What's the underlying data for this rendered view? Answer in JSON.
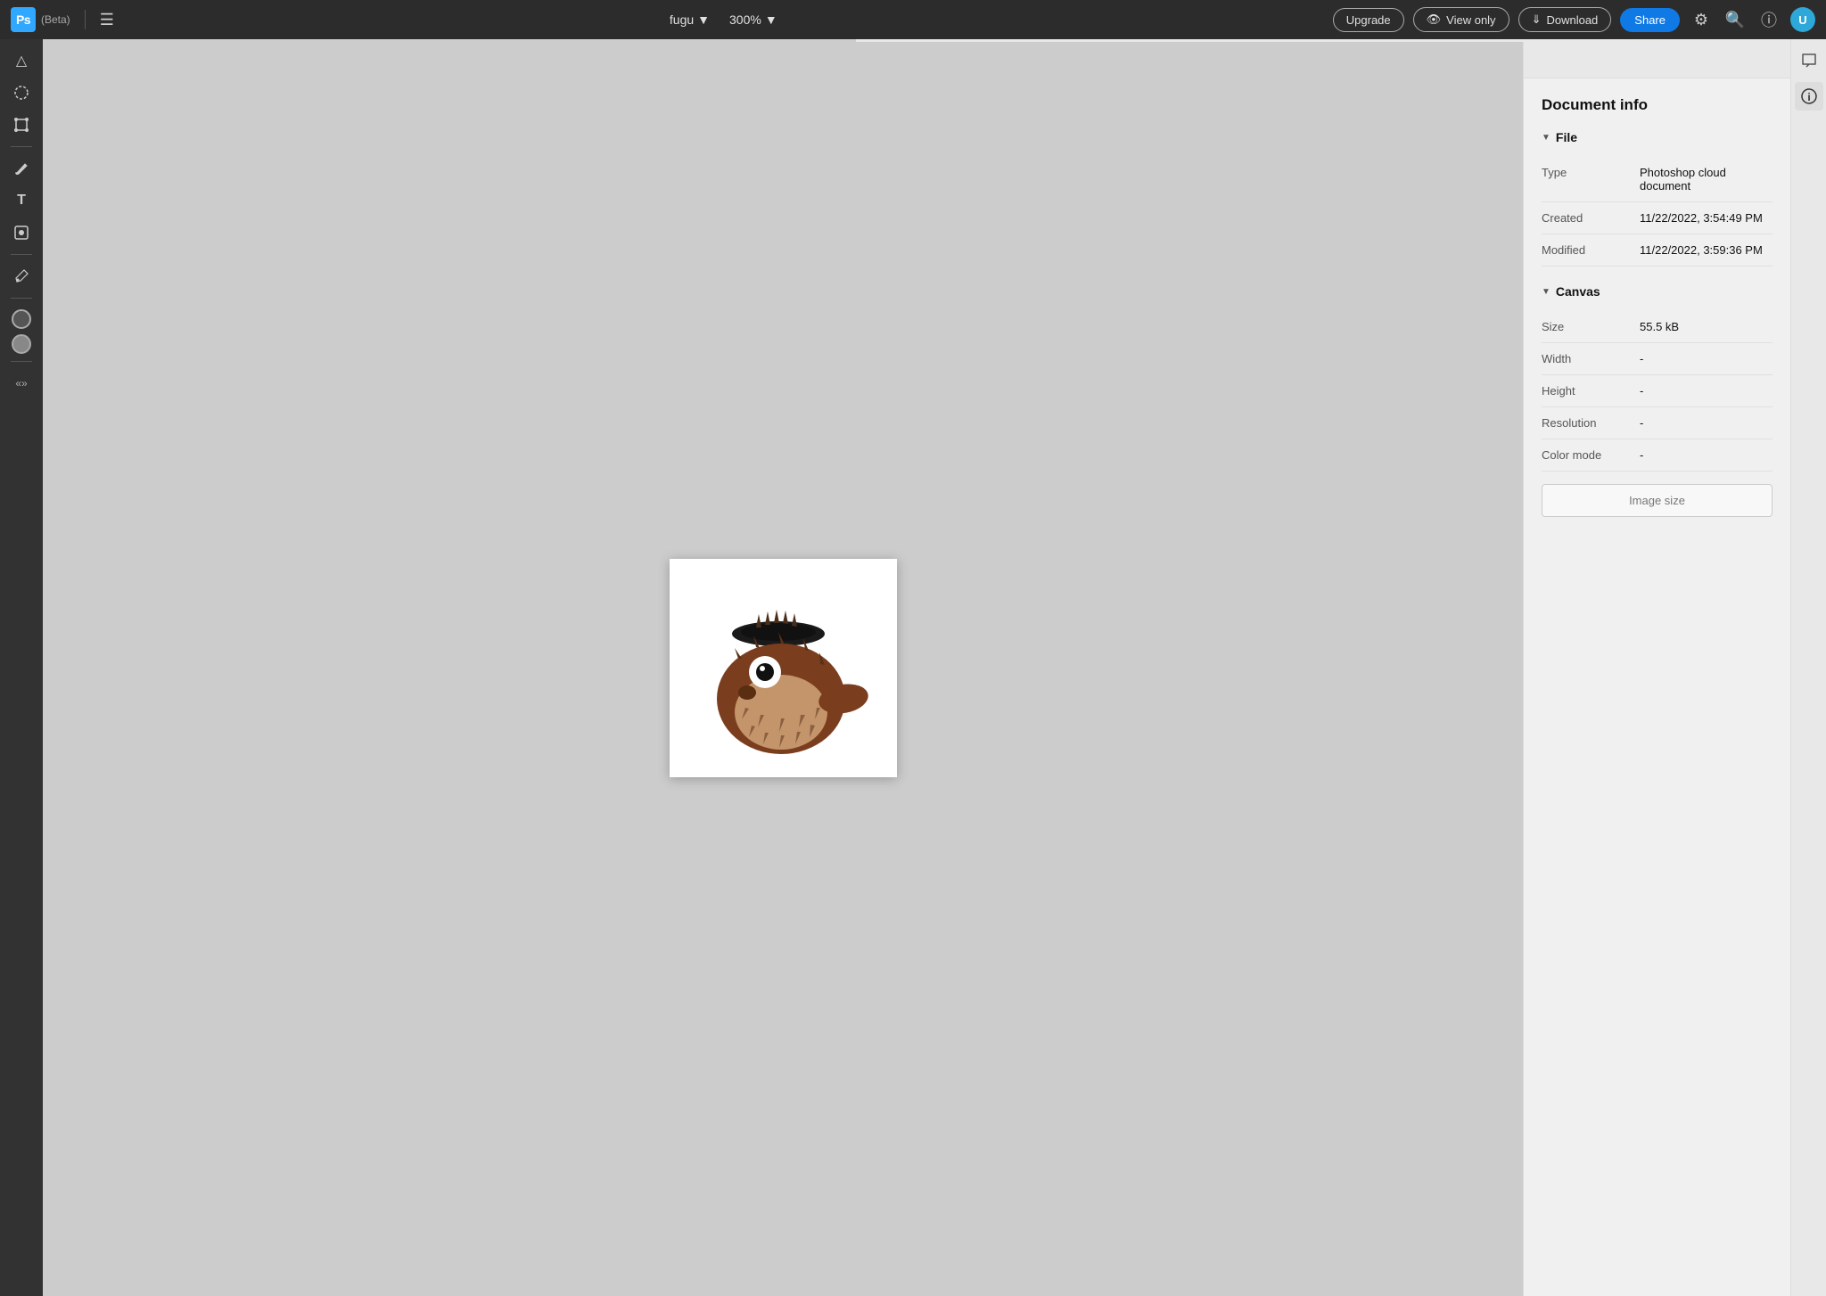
{
  "topbar": {
    "app_name": "Ps",
    "beta_label": "(Beta)",
    "file_name": "fugu",
    "zoom_level": "300%",
    "upgrade_label": "Upgrade",
    "view_only_label": "View only",
    "download_label": "Download",
    "share_label": "Share",
    "avatar_initials": "U"
  },
  "toolbar": {
    "tools": [
      {
        "name": "select-tool",
        "icon": "◁",
        "label": "Select"
      },
      {
        "name": "lasso-tool",
        "icon": "⬤",
        "label": "Lasso"
      },
      {
        "name": "transform-tool",
        "icon": "⊹",
        "label": "Transform"
      },
      {
        "name": "brush-tool",
        "icon": "✏",
        "label": "Brush"
      },
      {
        "name": "text-tool",
        "icon": "T",
        "label": "Type"
      },
      {
        "name": "shape-tool",
        "icon": "❖",
        "label": "Shape"
      },
      {
        "name": "eyedropper-tool",
        "icon": "⌲",
        "label": "Eyedropper"
      }
    ]
  },
  "document_info": {
    "title": "Document info",
    "file_section": "File",
    "type_label": "Type",
    "type_value": "Photoshop cloud document",
    "created_label": "Created",
    "created_value": "11/22/2022, 3:54:49 PM",
    "modified_label": "Modified",
    "modified_value": "11/22/2022, 3:59:36 PM",
    "canvas_section": "Canvas",
    "size_label": "Size",
    "size_value": "55.5 kB",
    "width_label": "Width",
    "width_value": "-",
    "height_label": "Height",
    "height_value": "-",
    "resolution_label": "Resolution",
    "resolution_value": "-",
    "color_mode_label": "Color mode",
    "color_mode_value": "-",
    "image_size_button": "Image size"
  }
}
